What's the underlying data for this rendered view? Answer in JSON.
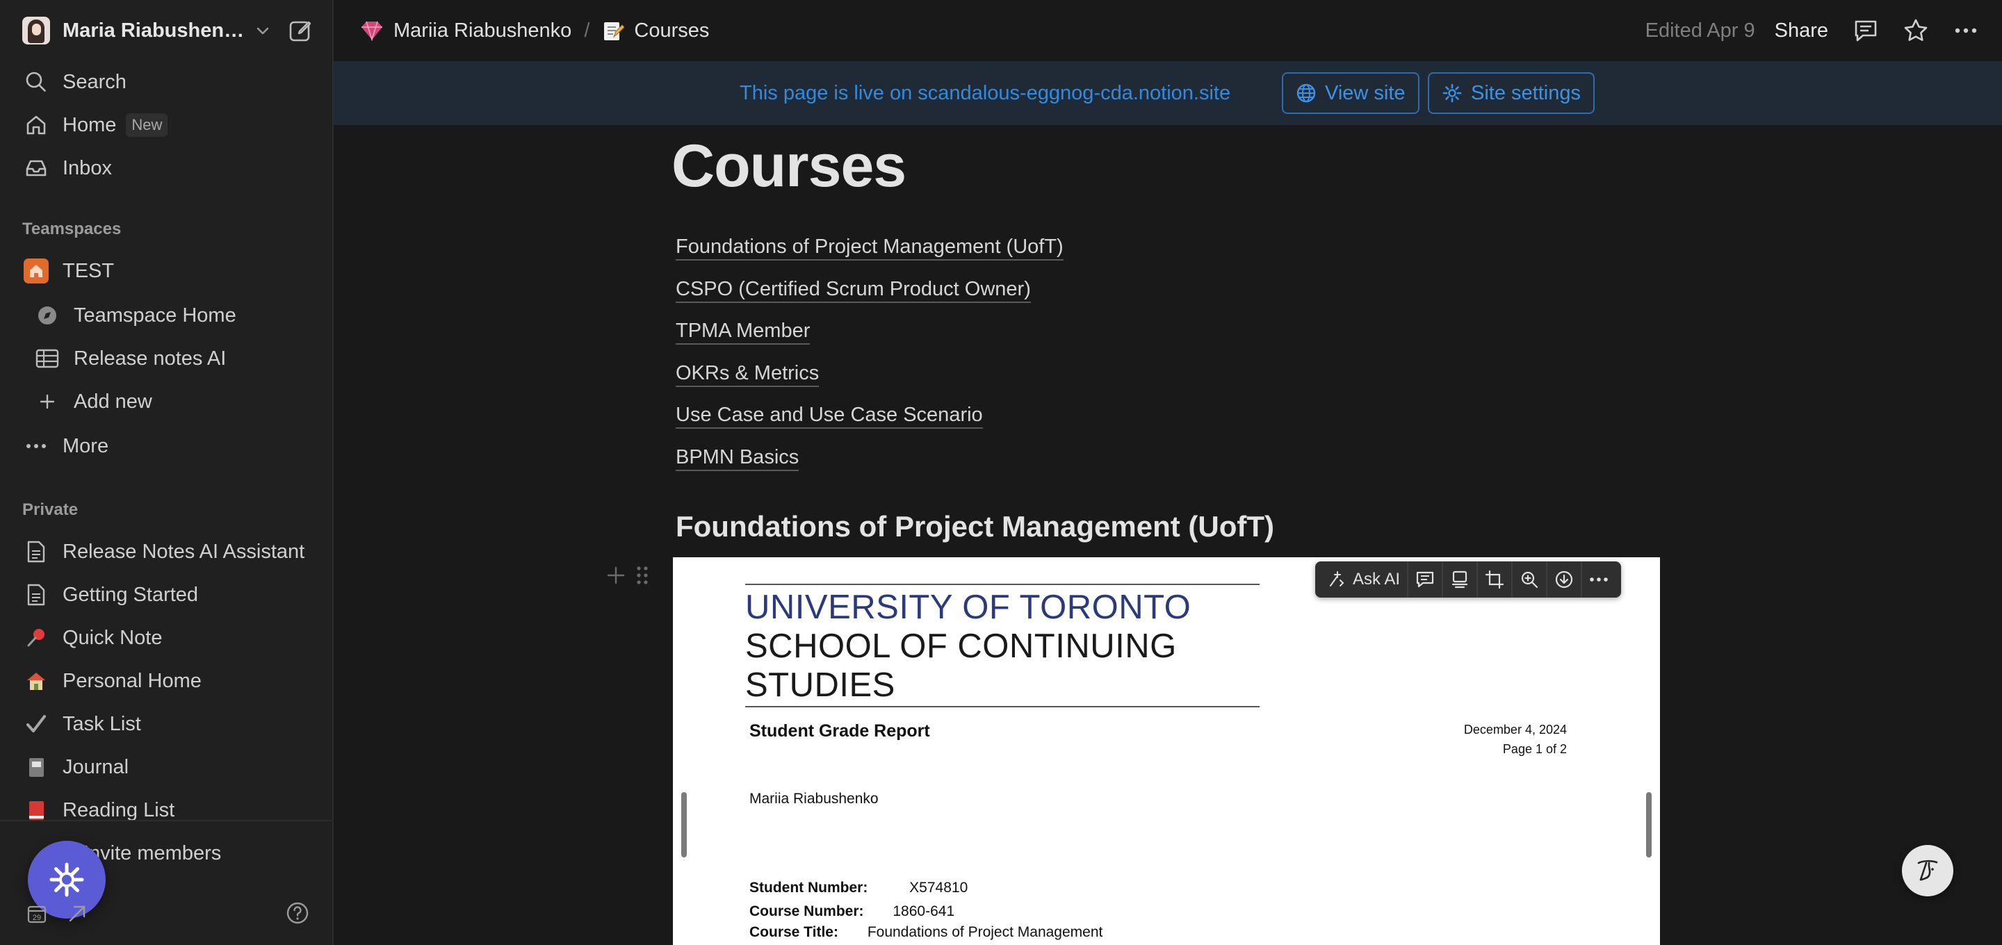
{
  "workspace": {
    "name": "Maria Riabushenko"
  },
  "nav": {
    "search": "Search",
    "home": "Home",
    "home_badge": "New",
    "inbox": "Inbox"
  },
  "teamspaces": {
    "label": "Teamspaces",
    "team_name": "TEST",
    "items": [
      "Teamspace Home",
      "Release notes AI",
      "Add new"
    ],
    "more": "More"
  },
  "private": {
    "label": "Private",
    "items": [
      {
        "label": "Release Notes AI Assistant",
        "icon": "page-icon"
      },
      {
        "label": "Getting Started",
        "icon": "page-icon"
      },
      {
        "label": "Quick Note",
        "icon": "pushpin-emoji"
      },
      {
        "label": "Personal Home",
        "icon": "house-emoji"
      },
      {
        "label": "Task List",
        "icon": "checkmark-emoji"
      },
      {
        "label": "Journal",
        "icon": "notebook-emoji"
      },
      {
        "label": "Reading List",
        "icon": "book-emoji"
      }
    ]
  },
  "footer": {
    "invite": "Invite members",
    "calendar_day": "29"
  },
  "breadcrumb": {
    "workspace": "Mariia Riabushenko",
    "page": "Courses"
  },
  "topbar": {
    "edited": "Edited Apr 9",
    "share": "Share"
  },
  "banner": {
    "text": "This page is live on scandalous-eggnog-cda.notion.site",
    "view_site": "View site",
    "site_settings": "Site settings"
  },
  "page": {
    "title": "Courses",
    "links": [
      "Foundations of Project Management (UofT)",
      "CSPO (Certified Scrum Product Owner)",
      "TPMA Member",
      "OKRs & Metrics",
      "Use Case and Use Case Scenario",
      "BPMN Basics"
    ],
    "section_heading": "Foundations of Project Management (UofT)"
  },
  "document": {
    "uni_line1": "UNIVERSITY OF TORONTO",
    "uni_line2": "SCHOOL OF CONTINUING STUDIES",
    "title": "Student Grade Report",
    "date": "December 4, 2024",
    "page": "Page 1 of 2",
    "student_name": "Mariia Riabushenko",
    "student_number_label": "Student Number:",
    "student_number": "X574810",
    "course_number_label": "Course Number:",
    "course_number": "1860-641",
    "course_title_label": "Course Title:",
    "course_title": "Foundations of Project Management"
  },
  "doc_toolbar": {
    "ask_ai": "Ask AI"
  },
  "colors": {
    "accent_blue": "#2f8be0",
    "fab_purple": "#5b5bd6",
    "team_orange": "#e16b2c",
    "background": "#191919",
    "sidebar": "#202020"
  }
}
